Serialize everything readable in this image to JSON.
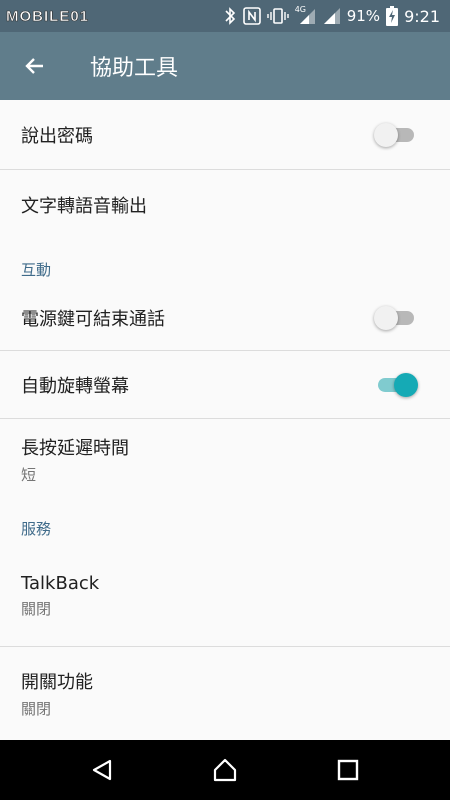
{
  "status_bar": {
    "watermark": "MOBILE01",
    "battery_percent": "91%",
    "time": "9:21",
    "network_label": "4G",
    "icons": [
      "bluetooth-icon",
      "nfc-icon",
      "vibrate-icon",
      "signal-icon",
      "battery-charging-icon"
    ]
  },
  "app_bar": {
    "title": "協助工具",
    "back_icon": "arrow-left-icon"
  },
  "settings": {
    "speak_passwords": {
      "title": "說出密碼",
      "enabled": false
    },
    "tts_output": {
      "title": "文字轉語音輸出"
    },
    "section_interaction": "互動",
    "power_ends_call": {
      "title": "電源鍵可結束通話",
      "enabled": false
    },
    "auto_rotate": {
      "title": "自動旋轉螢幕",
      "enabled": true
    },
    "long_press_delay": {
      "title": "長按延遲時間",
      "value": "短"
    },
    "section_services": "服務",
    "talkback": {
      "title": "TalkBack",
      "value": "關閉"
    },
    "switch_access": {
      "title": "開關功能",
      "value": "關閉"
    }
  },
  "nav_bar": {
    "icons": [
      "back-triangle-icon",
      "home-icon",
      "recents-square-icon"
    ]
  },
  "colors": {
    "status_bar": "#4f6776",
    "app_bar": "#607d8b",
    "section_header": "#3f6b8a",
    "toggle_on": "#15aab5"
  }
}
